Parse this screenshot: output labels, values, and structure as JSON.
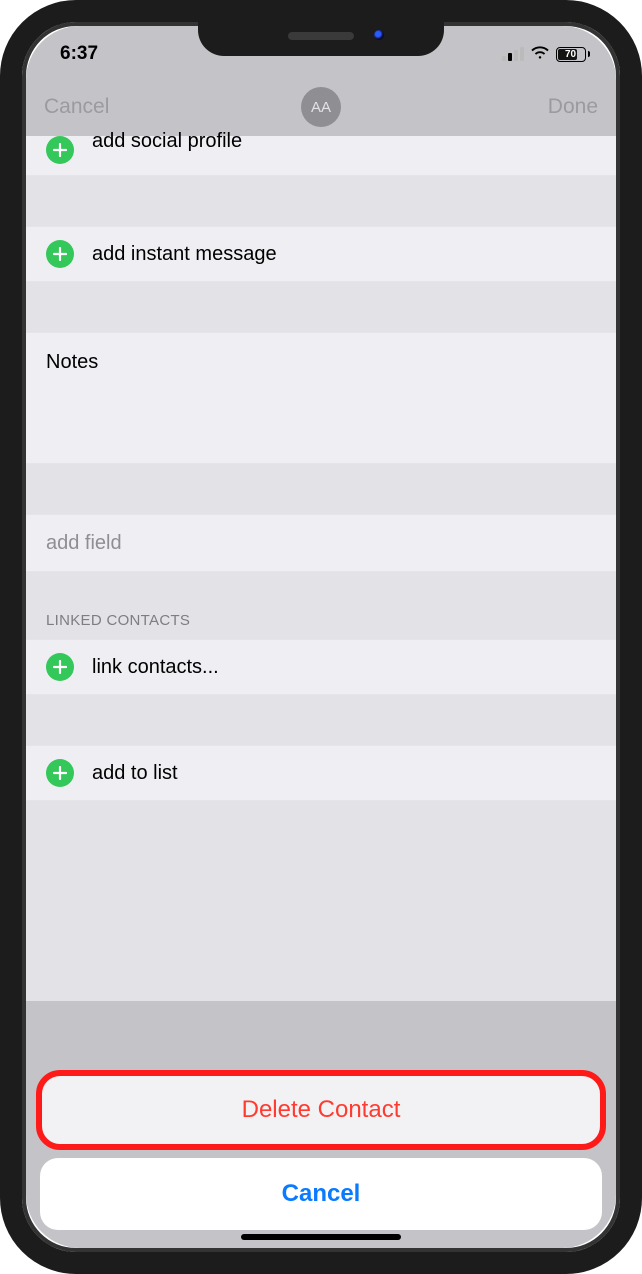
{
  "status": {
    "time": "6:37",
    "battery": "70"
  },
  "nav": {
    "cancel": "Cancel",
    "done": "Done",
    "avatar_initials": "AA"
  },
  "rows": {
    "social": "add social profile",
    "im": "add instant message",
    "notes_label": "Notes",
    "add_field": "add field",
    "linked_header": "LINKED CONTACTS",
    "link_contacts": "link contacts...",
    "add_to_list": "add to list"
  },
  "sheet": {
    "delete": "Delete Contact",
    "cancel": "Cancel"
  }
}
